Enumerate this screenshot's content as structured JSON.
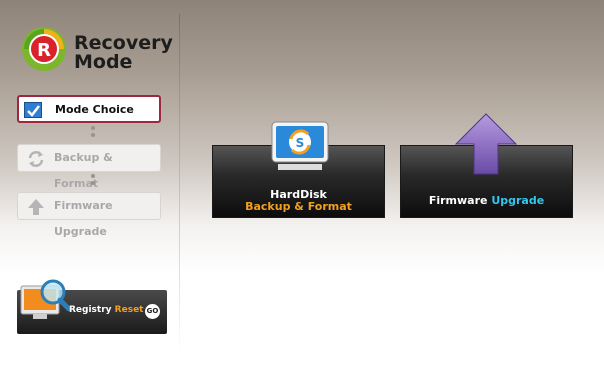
{
  "logo": {
    "line1": "Recovery",
    "line2": "Mode",
    "badge": "R"
  },
  "steps": [
    {
      "label": "Mode Choice",
      "state": "active",
      "icon": "checkbox-checked-icon"
    },
    {
      "label": "Backup & Format",
      "state": "disabled",
      "icon": "sync-arrows-icon"
    },
    {
      "label": "Firmware Upgrade",
      "state": "disabled",
      "icon": "up-arrow-icon"
    }
  ],
  "registry": {
    "prefix": "Registry",
    "accent": "Reset",
    "go": "GO"
  },
  "tiles": {
    "harddisk": {
      "line1": "HardDisk",
      "line2": "Backup & Format",
      "icon_badge": "S"
    },
    "firmware": {
      "prefix": "Firmware",
      "accent": "Upgrade"
    }
  },
  "colors": {
    "active_border": "#9c2840",
    "orange_accent": "#f3a020",
    "cyan_accent": "#35c6ef",
    "logo_green": "#7cb62a",
    "logo_red": "#d8232a"
  }
}
